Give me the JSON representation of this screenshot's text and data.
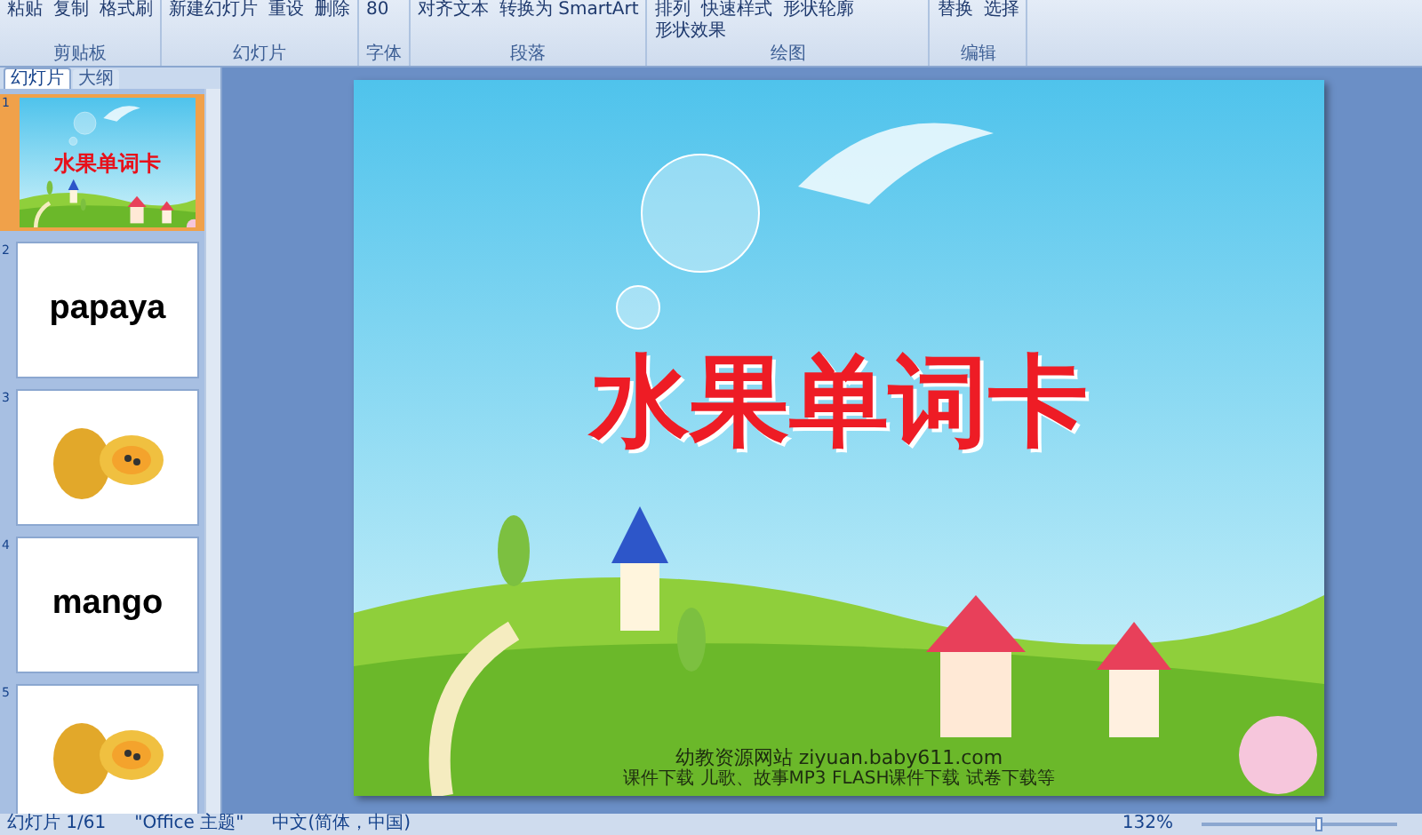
{
  "ribbon": {
    "groups": [
      {
        "label": "剪贴板",
        "items": [
          "粘贴",
          "复制",
          "格式刷"
        ]
      },
      {
        "label": "幻灯片",
        "items": [
          "新建幻灯片",
          "重设",
          "删除"
        ]
      },
      {
        "label": "字体",
        "items": [
          "80"
        ]
      },
      {
        "label": "段落",
        "items": [
          "对齐文本",
          "转换为 SmartArt"
        ]
      },
      {
        "label": "绘图",
        "items": [
          "排列",
          "快速样式",
          "形状轮廓",
          "形状效果"
        ]
      },
      {
        "label": "编辑",
        "items": [
          "替换",
          "选择"
        ]
      }
    ]
  },
  "pane_tabs": [
    {
      "label": "幻灯片",
      "selected": true
    },
    {
      "label": "大纲",
      "selected": false
    }
  ],
  "thumbnails": [
    {
      "number": "1",
      "kind": "title",
      "text": "水果单词卡",
      "selected": true
    },
    {
      "number": "2",
      "kind": "word",
      "text": "papaya",
      "selected": false
    },
    {
      "number": "3",
      "kind": "picture",
      "selected": false
    },
    {
      "number": "4",
      "kind": "word",
      "text": "mango",
      "selected": false
    },
    {
      "number": "5",
      "kind": "picture",
      "selected": false
    }
  ],
  "slide": {
    "title": "水果单词卡",
    "site": "幼教资源网站  ziyuan.baby611.com",
    "links": "课件下载   儿歌、故事MP3   FLASH课件下载   试卷下载等"
  },
  "status_bar": {
    "slide": "幻灯片 1/61",
    "theme": "\"Office 主题\"",
    "language": "中文(简体，中国)",
    "zoom": "132%",
    "zoom_slider": {
      "level": 0.6
    }
  }
}
